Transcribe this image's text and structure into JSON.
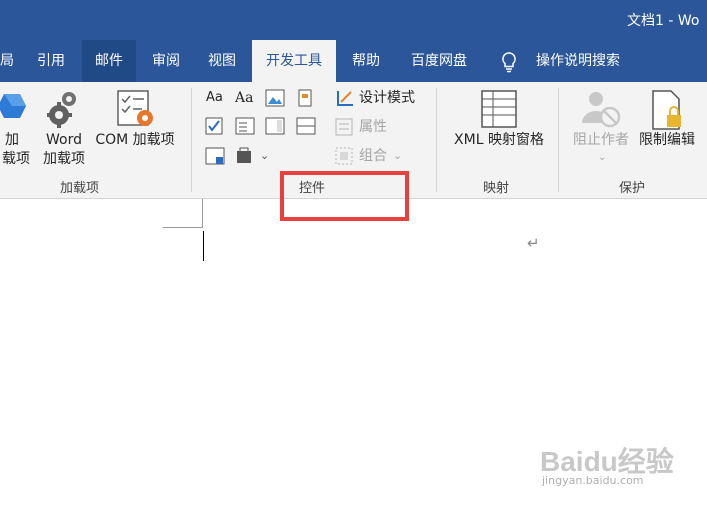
{
  "window": {
    "title": "文档1 - Wo"
  },
  "tabs": [
    {
      "label": "局",
      "state": "normal"
    },
    {
      "label": "引用",
      "state": "normal"
    },
    {
      "label": "邮件",
      "state": "hover"
    },
    {
      "label": "审阅",
      "state": "normal"
    },
    {
      "label": "视图",
      "state": "normal"
    },
    {
      "label": "开发工具",
      "state": "active"
    },
    {
      "label": "帮助",
      "state": "normal"
    },
    {
      "label": "百度网盘",
      "state": "normal"
    }
  ],
  "tell_me": {
    "label": "操作说明搜索",
    "icon": "lightbulb-icon"
  },
  "ribbon": {
    "addins_group": {
      "label": "加载项",
      "addins_button": {
        "line1": "加",
        "line2": "载项"
      },
      "word_addins_button": {
        "line1": "Word",
        "line2": "加载项"
      },
      "com_addins_button": {
        "label": "COM 加载项"
      }
    },
    "controls_group": {
      "label": "控件",
      "design_mode": "设计模式",
      "properties": "属性",
      "group": "组合",
      "aa_plain": "Aa",
      "aa_rich": "Aa"
    },
    "mapping_group": {
      "label": "映射",
      "xml_pane": "XML 映射窗格"
    },
    "protect_group": {
      "label": "保护",
      "block_authors": "阻止作者",
      "restrict_editing": "限制编辑"
    }
  },
  "document": {
    "paragraph_mark": "↵"
  },
  "watermark": {
    "logo": "Baidu经验",
    "url": "jingyan.baidu.com"
  },
  "colors": {
    "accent": "#2b579a",
    "highlight": "#e8403c"
  }
}
